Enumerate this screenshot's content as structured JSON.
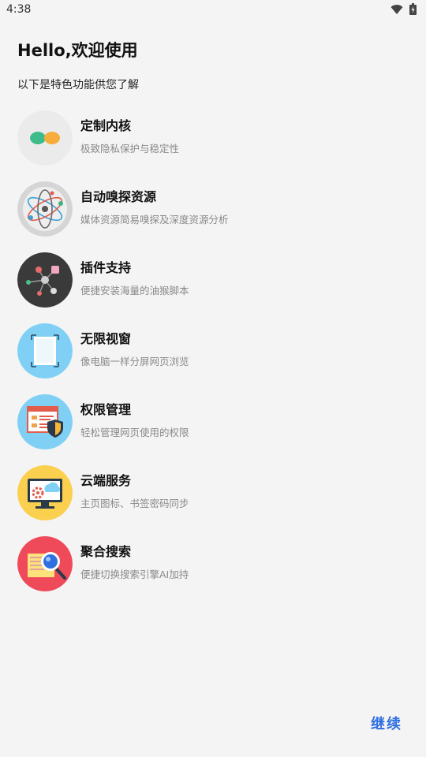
{
  "status_bar": {
    "time": "4:38"
  },
  "header": {
    "title": "Hello,欢迎使用",
    "subtitle": "以下是特色功能供您了解"
  },
  "features": [
    {
      "title": "定制内核",
      "desc": "极致隐私保护与稳定性",
      "icon": "kernel-icon"
    },
    {
      "title": "自动嗅探资源",
      "desc": "媒体资源简易嗅探及深度资源分析",
      "icon": "atom-icon"
    },
    {
      "title": "插件支持",
      "desc": "便捷安装海量的油猴脚本",
      "icon": "plugin-network-icon"
    },
    {
      "title": "无限视窗",
      "desc": "像电脑一样分屏网页浏览",
      "icon": "window-icon"
    },
    {
      "title": "权限管理",
      "desc": "轻松管理网页使用的权限",
      "icon": "shield-document-icon"
    },
    {
      "title": "云端服务",
      "desc": "主页图标、书签密码同步",
      "icon": "cloud-monitor-icon"
    },
    {
      "title": "聚合搜索",
      "desc": "便捷切换搜索引擎AI加持",
      "icon": "magnifier-icon"
    }
  ],
  "footer": {
    "continue_label": "继续"
  },
  "colors": {
    "accent": "#2f6fe0",
    "background": "#f4f4f4"
  }
}
